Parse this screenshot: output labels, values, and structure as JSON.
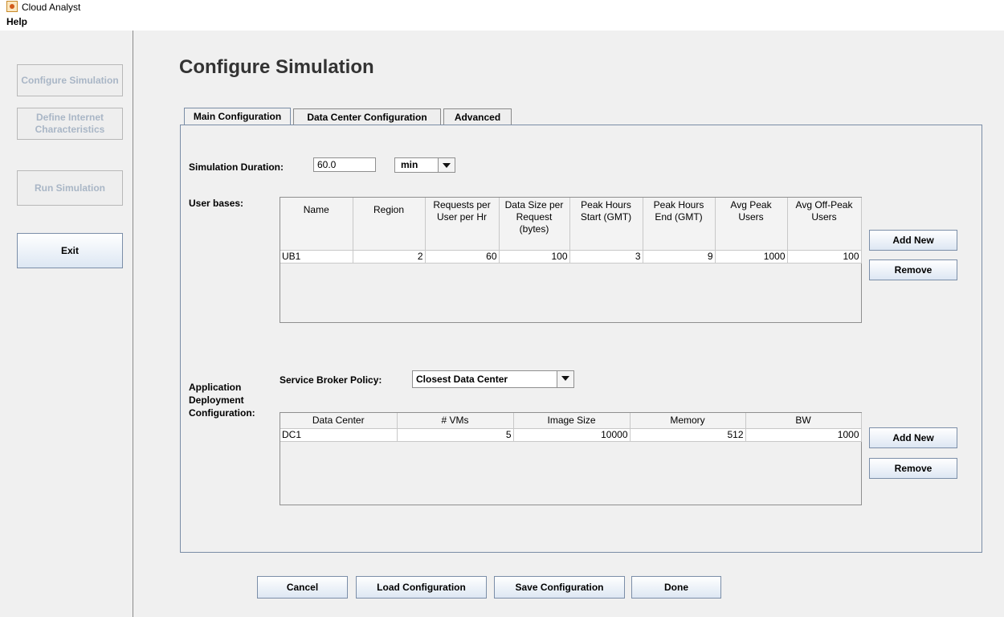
{
  "window": {
    "title": "Cloud Analyst"
  },
  "menu": {
    "help": "Help"
  },
  "sidebar": {
    "configure": "Configure Simulation",
    "define": "Define Internet Characteristics",
    "run": "Run Simulation",
    "exit": "Exit"
  },
  "page": {
    "title": "Configure Simulation"
  },
  "tabs": [
    "Main Configuration",
    "Data Center Configuration",
    "Advanced"
  ],
  "main": {
    "duration_label": "Simulation Duration:",
    "duration_value": "60.0",
    "duration_unit": "min",
    "user_bases_label": "User bases:",
    "user_bases": {
      "headers": [
        "Name",
        "Region",
        "Requests per User per Hr",
        "Data Size per Request (bytes)",
        "Peak Hours Start (GMT)",
        "Peak Hours End (GMT)",
        "Avg Peak Users",
        "Avg Off-Peak Users"
      ],
      "rows": [
        [
          "UB1",
          "2",
          "60",
          "100",
          "3",
          "9",
          "1000",
          "100"
        ]
      ]
    },
    "add_new": "Add New",
    "remove": "Remove",
    "app_deploy_label": "Application Deployment Configuration:",
    "broker_label": "Service Broker Policy:",
    "broker_value": "Closest Data Center",
    "deploy": {
      "headers": [
        "Data Center",
        "# VMs",
        "Image Size",
        "Memory",
        "BW"
      ],
      "rows": [
        [
          "DC1",
          "5",
          "10000",
          "512",
          "1000"
        ]
      ]
    }
  },
  "footer": {
    "cancel": "Cancel",
    "load": "Load Configuration",
    "save": "Save Configuration",
    "done": "Done"
  }
}
